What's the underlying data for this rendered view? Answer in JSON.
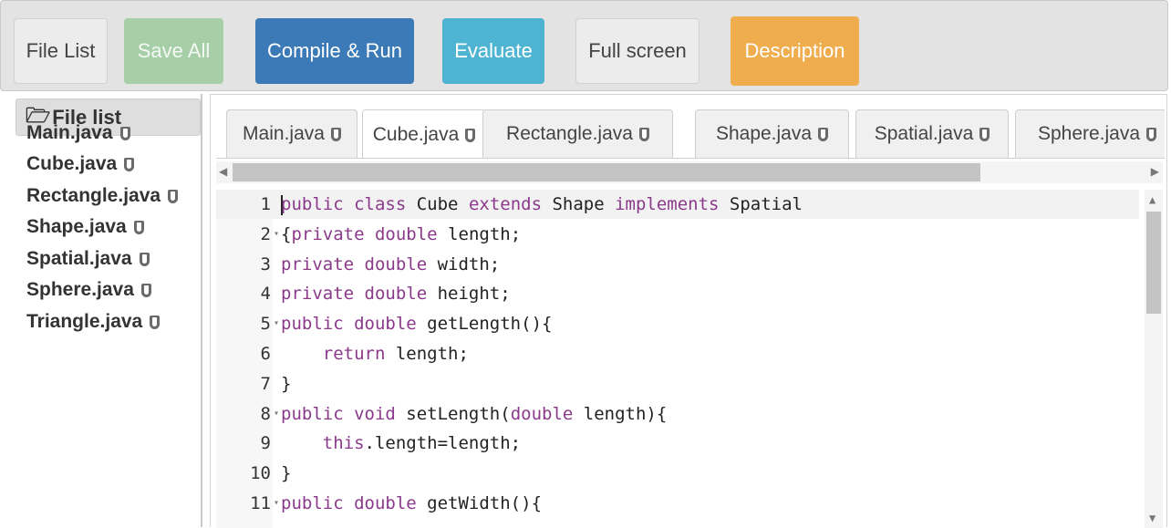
{
  "toolbar": {
    "file_list": "File List",
    "save_all": "Save All",
    "compile_run": "Compile & Run",
    "evaluate": "Evaluate",
    "full_screen": "Full screen",
    "description": "Description"
  },
  "sidebar": {
    "header": "File list",
    "items": [
      "Main.java",
      "Cube.java",
      "Rectangle.java",
      "Shape.java",
      "Spatial.java",
      "Sphere.java",
      "Triangle.java"
    ]
  },
  "tabs": [
    "Main.java",
    "Cube.java",
    "Rectangle.java",
    "Shape.java",
    "Spatial.java",
    "Sphere.java"
  ],
  "active_tab": "Cube.java",
  "colors": {
    "keyword": "#8b3a8b",
    "compile_button": "#3b7ab6",
    "evaluate_button": "#4fb4d2",
    "description_button": "#f0ad4e",
    "save_all_disabled": "#a6cfa8"
  },
  "code": {
    "lines": [
      {
        "n": "1",
        "fold": false,
        "tokens": [
          {
            "t": "public",
            "k": true
          },
          {
            "t": " "
          },
          {
            "t": "class",
            "k": true
          },
          {
            "t": " Cube "
          },
          {
            "t": "extends",
            "k": true
          },
          {
            "t": " Shape "
          },
          {
            "t": "implements",
            "k": true
          },
          {
            "t": " Spatial"
          }
        ]
      },
      {
        "n": "2",
        "fold": true,
        "tokens": [
          {
            "t": "{"
          },
          {
            "t": "private",
            "k": true
          },
          {
            "t": " "
          },
          {
            "t": "double",
            "k": true
          },
          {
            "t": " length;"
          }
        ]
      },
      {
        "n": "3",
        "fold": false,
        "tokens": [
          {
            "t": "private",
            "k": true
          },
          {
            "t": " "
          },
          {
            "t": "double",
            "k": true
          },
          {
            "t": " width;"
          }
        ]
      },
      {
        "n": "4",
        "fold": false,
        "tokens": [
          {
            "t": "private",
            "k": true
          },
          {
            "t": " "
          },
          {
            "t": "double",
            "k": true
          },
          {
            "t": " height;"
          }
        ]
      },
      {
        "n": "5",
        "fold": true,
        "tokens": [
          {
            "t": "public",
            "k": true
          },
          {
            "t": " "
          },
          {
            "t": "double",
            "k": true
          },
          {
            "t": " getLength(){"
          }
        ]
      },
      {
        "n": "6",
        "fold": false,
        "tokens": [
          {
            "t": "    "
          },
          {
            "t": "return",
            "k": true
          },
          {
            "t": " length;"
          }
        ]
      },
      {
        "n": "7",
        "fold": false,
        "tokens": [
          {
            "t": "}"
          }
        ]
      },
      {
        "n": "8",
        "fold": true,
        "tokens": [
          {
            "t": "public",
            "k": true
          },
          {
            "t": " "
          },
          {
            "t": "void",
            "k": true
          },
          {
            "t": " setLength("
          },
          {
            "t": "double",
            "k": true
          },
          {
            "t": " length){"
          }
        ]
      },
      {
        "n": "9",
        "fold": false,
        "tokens": [
          {
            "t": "    "
          },
          {
            "t": "this",
            "k": true
          },
          {
            "t": ".length=length;"
          }
        ]
      },
      {
        "n": "10",
        "fold": false,
        "tokens": [
          {
            "t": "}"
          }
        ]
      },
      {
        "n": "11",
        "fold": true,
        "tokens": [
          {
            "t": "public",
            "k": true
          },
          {
            "t": " "
          },
          {
            "t": "double",
            "k": true
          },
          {
            "t": " getWidth(){"
          }
        ]
      }
    ]
  }
}
